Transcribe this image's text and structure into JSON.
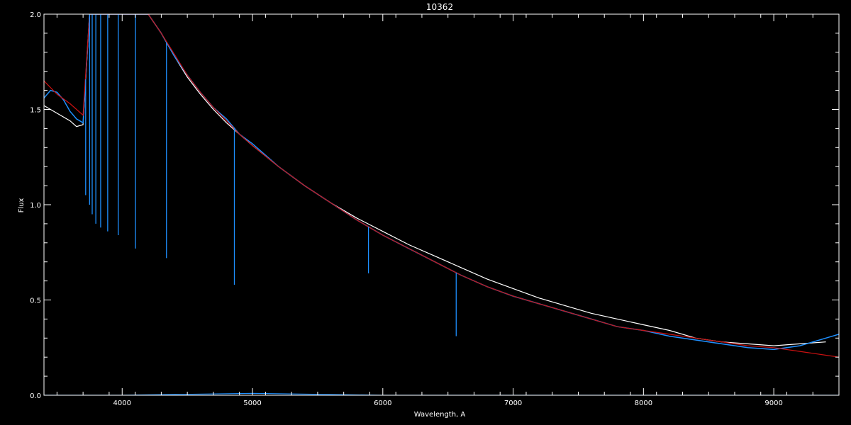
{
  "chart_data": {
    "type": "line",
    "title": "10362",
    "xlabel": "Wavelength, A",
    "ylabel": "Flux",
    "xlim": [
      3400,
      9500
    ],
    "ylim": [
      0.0,
      2.0
    ],
    "x_ticks": [
      4000,
      5000,
      6000,
      7000,
      8000,
      9000
    ],
    "y_ticks": [
      0.0,
      0.5,
      1.0,
      1.5,
      2.0
    ],
    "x_tick_labels": [
      "4000",
      "5000",
      "6000",
      "7000",
      "8000",
      "9000"
    ],
    "y_tick_labels": [
      "0.0",
      "0.5",
      "1.0",
      "1.5",
      "2.0"
    ],
    "grid": false,
    "background": "#000000",
    "series": [
      {
        "color": "#ffffff",
        "x": [
          3400,
          3500,
          3600,
          3650,
          3700,
          3750,
          3800,
          3900,
          4000,
          4100,
          4200,
          4300,
          4400,
          4500,
          4600,
          4700,
          4800,
          4900,
          5000,
          5200,
          5400,
          5600,
          5800,
          6000,
          6200,
          6400,
          6600,
          6800,
          7000,
          7200,
          7400,
          7600,
          7800,
          8000,
          8200,
          8400,
          8600,
          8800,
          9000,
          9200,
          9400
        ],
        "y": [
          1.52,
          1.48,
          1.44,
          1.41,
          1.42,
          2.0,
          2.0,
          2.0,
          2.0,
          2.0,
          2.0,
          1.9,
          1.78,
          1.67,
          1.58,
          1.5,
          1.43,
          1.37,
          1.31,
          1.2,
          1.1,
          1.01,
          0.93,
          0.86,
          0.79,
          0.73,
          0.67,
          0.61,
          0.56,
          0.51,
          0.47,
          0.43,
          0.4,
          0.37,
          0.34,
          0.3,
          0.28,
          0.27,
          0.26,
          0.27,
          0.28
        ]
      },
      {
        "color": "#1e90ff",
        "x": [
          3400,
          3450,
          3500,
          3550,
          3600,
          3650,
          3700,
          3750,
          3800,
          3900,
          4000,
          4100,
          4200,
          4300,
          4400,
          4500,
          4600,
          4700,
          4800,
          4900,
          5000,
          5200,
          5400,
          5600,
          5800,
          6000,
          6200,
          6400,
          6600,
          6800,
          7000,
          7200,
          7400,
          7600,
          7800,
          8000,
          8200,
          8400,
          8600,
          8800,
          9000,
          9200,
          9400,
          9500
        ],
        "y": [
          1.56,
          1.6,
          1.59,
          1.55,
          1.49,
          1.45,
          1.43,
          2.0,
          2.0,
          2.0,
          2.0,
          2.0,
          2.0,
          1.9,
          1.78,
          1.68,
          1.59,
          1.51,
          1.45,
          1.37,
          1.32,
          1.2,
          1.1,
          1.01,
          0.92,
          0.84,
          0.77,
          0.7,
          0.63,
          0.57,
          0.52,
          0.48,
          0.44,
          0.4,
          0.36,
          0.34,
          0.31,
          0.29,
          0.27,
          0.25,
          0.24,
          0.26,
          0.3,
          0.32
        ]
      },
      {
        "color": "#cc1111",
        "x": [
          3400,
          3500,
          3600,
          3700,
          3750,
          3800,
          3900,
          4000,
          4100,
          4200,
          4300,
          4400,
          4500,
          4600,
          4700,
          4800,
          4900,
          5000,
          5200,
          5400,
          5600,
          5800,
          6000,
          6200,
          6400,
          6600,
          6800,
          7000,
          7200,
          7400,
          7600,
          7800,
          8000,
          8200,
          8400,
          8600,
          8800,
          9000,
          9200,
          9400,
          9500
        ],
        "y": [
          1.65,
          1.58,
          1.53,
          1.47,
          2.0,
          2.0,
          2.0,
          2.0,
          2.0,
          2.0,
          1.9,
          1.79,
          1.68,
          1.59,
          1.51,
          1.44,
          1.37,
          1.31,
          1.2,
          1.1,
          1.01,
          0.92,
          0.84,
          0.77,
          0.7,
          0.63,
          0.57,
          0.52,
          0.48,
          0.44,
          0.4,
          0.36,
          0.34,
          0.32,
          0.3,
          0.28,
          0.26,
          0.25,
          0.23,
          0.21,
          0.2
        ]
      },
      {
        "color": "#1e90ff",
        "x": [
          3400,
          4000,
          5000,
          6000,
          7000,
          8000,
          9000,
          9500
        ],
        "y": [
          0.0,
          0.0,
          0.01,
          0.0,
          0.0,
          0.0,
          0.0,
          0.0
        ]
      }
    ],
    "absorption_lines": [
      {
        "x": 3720,
        "depth_to": 1.05
      },
      {
        "x": 3750,
        "depth_to": 1.0
      },
      {
        "x": 3770,
        "depth_to": 0.95
      },
      {
        "x": 3798,
        "depth_to": 0.9
      },
      {
        "x": 3835,
        "depth_to": 0.88
      },
      {
        "x": 3889,
        "depth_to": 0.86
      },
      {
        "x": 3970,
        "depth_to": 0.84
      },
      {
        "x": 4102,
        "depth_to": 0.77
      },
      {
        "x": 4340,
        "depth_to": 0.72
      },
      {
        "x": 4861,
        "depth_to": 0.58
      },
      {
        "x": 5890,
        "depth_to": 0.64
      },
      {
        "x": 6563,
        "depth_to": 0.31
      }
    ]
  }
}
